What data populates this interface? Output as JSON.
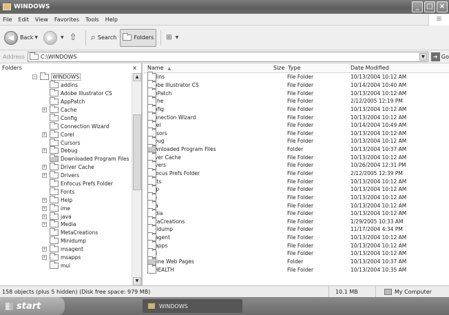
{
  "window": {
    "title": "WINDOWS"
  },
  "menu": [
    "File",
    "Edit",
    "View",
    "Favorites",
    "Tools",
    "Help"
  ],
  "toolbar": {
    "back": "Back",
    "search": "Search",
    "folders": "Folders"
  },
  "address": {
    "label": "Address",
    "value": "C:\\WINDOWS",
    "go": "Go"
  },
  "left_pane": {
    "title": "Folders",
    "close": "×",
    "tree": [
      {
        "label": "WINDOWS",
        "exp": "−",
        "indent": 0,
        "selected": true
      },
      {
        "label": "addins",
        "exp": "",
        "indent": 1
      },
      {
        "label": "Adobe Illustrator CS",
        "exp": "",
        "indent": 1
      },
      {
        "label": "AppPatch",
        "exp": "",
        "indent": 1
      },
      {
        "label": "Cache",
        "exp": "+",
        "indent": 1
      },
      {
        "label": "Config",
        "exp": "",
        "indent": 1
      },
      {
        "label": "Connection Wizard",
        "exp": "",
        "indent": 1
      },
      {
        "label": "Corel",
        "exp": "+",
        "indent": 1
      },
      {
        "label": "Cursors",
        "exp": "",
        "indent": 1
      },
      {
        "label": "Debug",
        "exp": "+",
        "indent": 1
      },
      {
        "label": "Downloaded Program Files",
        "exp": "",
        "indent": 1,
        "special": true
      },
      {
        "label": "Driver Cache",
        "exp": "+",
        "indent": 1
      },
      {
        "label": "Drivers",
        "exp": "+",
        "indent": 1
      },
      {
        "label": "Enfocus Prefs Folder",
        "exp": "",
        "indent": 1
      },
      {
        "label": "Fonts",
        "exp": "",
        "indent": 1
      },
      {
        "label": "Help",
        "exp": "+",
        "indent": 1
      },
      {
        "label": "ime",
        "exp": "+",
        "indent": 1
      },
      {
        "label": "java",
        "exp": "+",
        "indent": 1
      },
      {
        "label": "Media",
        "exp": "+",
        "indent": 1
      },
      {
        "label": "MetaCreations",
        "exp": "",
        "indent": 1
      },
      {
        "label": "Minidump",
        "exp": "",
        "indent": 1
      },
      {
        "label": "msagent",
        "exp": "+",
        "indent": 1
      },
      {
        "label": "msapps",
        "exp": "+",
        "indent": 1
      },
      {
        "label": "mui",
        "exp": "",
        "indent": 1
      }
    ]
  },
  "columns": {
    "name": "Name",
    "sort_arrow": "▲",
    "size": "Size",
    "type": "Type",
    "date": "Date Modified"
  },
  "files": [
    {
      "name": "addins",
      "type": "File Folder",
      "date": "10/13/2004 10:12 AM"
    },
    {
      "name": "Adobe Illustrator CS",
      "type": "File Folder",
      "date": "10/14/2004 10:40 AM"
    },
    {
      "name": "AppPatch",
      "type": "File Folder",
      "date": "10/13/2004 10:12 AM"
    },
    {
      "name": "Cache",
      "type": "File Folder",
      "date": "2/12/2005 12:19 PM"
    },
    {
      "name": "Config",
      "type": "File Folder",
      "date": "10/13/2004 10:12 AM"
    },
    {
      "name": "Connection Wizard",
      "type": "File Folder",
      "date": "10/13/2004 10:12 AM"
    },
    {
      "name": "Corel",
      "type": "File Folder",
      "date": "10/14/2004 10:49 AM"
    },
    {
      "name": "Cursors",
      "type": "File Folder",
      "date": "10/13/2004 10:12 AM"
    },
    {
      "name": "Debug",
      "type": "File Folder",
      "date": "10/13/2004 10:12 AM"
    },
    {
      "name": "Downloaded Program Files",
      "type": "Folder",
      "date": "10/13/2004 10:37 AM",
      "special": true
    },
    {
      "name": "Driver Cache",
      "type": "File Folder",
      "date": "10/13/2004 10:12 AM"
    },
    {
      "name": "Drivers",
      "type": "File Folder",
      "date": "10/26/2004 12:31 PM"
    },
    {
      "name": "Enfocus Prefs Folder",
      "type": "File Folder",
      "date": "2/12/2005 12:39 PM"
    },
    {
      "name": "Fonts",
      "type": "File Folder",
      "date": "10/13/2004 10:12 AM"
    },
    {
      "name": "Help",
      "type": "File Folder",
      "date": "10/13/2004 10:12 AM"
    },
    {
      "name": "ime",
      "type": "File Folder",
      "date": "10/13/2004 10:12 AM"
    },
    {
      "name": "java",
      "type": "File Folder",
      "date": "10/13/2004 10:12 AM"
    },
    {
      "name": "Media",
      "type": "File Folder",
      "date": "10/13/2004 10:12 AM"
    },
    {
      "name": "MetaCreations",
      "type": "File Folder",
      "date": "1/29/2005 10:33 AM"
    },
    {
      "name": "Minidump",
      "type": "File Folder",
      "date": "11/17/2004 4:34 PM"
    },
    {
      "name": "msagent",
      "type": "File Folder",
      "date": "10/13/2004 10:12 AM"
    },
    {
      "name": "msapps",
      "type": "File Folder",
      "date": "10/13/2004 10:12 AM"
    },
    {
      "name": "mui",
      "type": "File Folder",
      "date": "10/13/2004 10:12 AM"
    },
    {
      "name": "Offline Web Pages",
      "type": "Folder",
      "date": "10/13/2004 10:37 AM",
      "special": true
    },
    {
      "name": "PCHEALTH",
      "type": "File Folder",
      "date": "10/13/2004 10:35 AM"
    }
  ],
  "status": {
    "objects": "158 objects (plus 5 hidden) (Disk free space: 979 MB)",
    "size": "10.1 MB",
    "location": "My Computer"
  },
  "taskbar": {
    "start": "start",
    "item": "WINDOWS"
  }
}
